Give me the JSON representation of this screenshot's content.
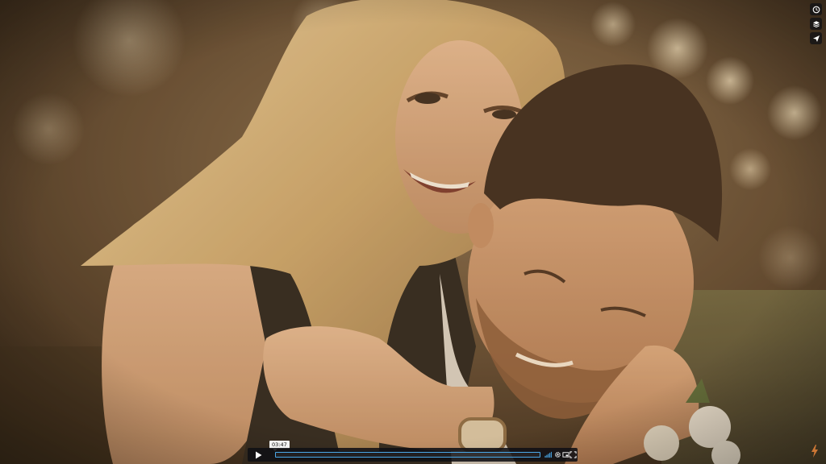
{
  "video": {
    "current_time": "03:47",
    "progress_fraction": 0.0
  },
  "colors": {
    "accent": "#4aa8e8",
    "bar_bg": "#101014",
    "brand_bolt": "#e8843a"
  },
  "icons": {
    "side": [
      "clock-icon",
      "layers-icon",
      "send-icon"
    ],
    "controls": [
      "play-icon",
      "volume-icon",
      "gear-icon",
      "pip-icon",
      "fullscreen-icon"
    ],
    "brand": "bolt-icon"
  }
}
